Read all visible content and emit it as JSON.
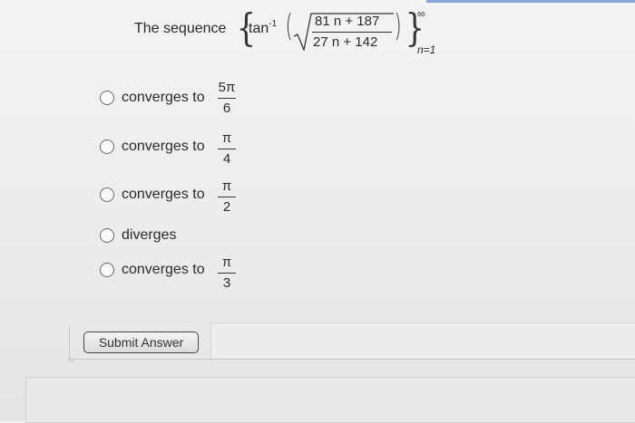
{
  "question": {
    "prefix": "The sequence",
    "open_brace": "{",
    "close_brace": "}",
    "func": "tan",
    "func_sup": "-1",
    "open_paren": "(",
    "close_paren": ")",
    "numerator": "81 n + 187",
    "denominator": "27 n + 142",
    "upper": "∞",
    "lower": "n=1"
  },
  "options": [
    {
      "text": "converges to",
      "num": "5π",
      "den": "6"
    },
    {
      "text": "converges to",
      "num": "π",
      "den": "4"
    },
    {
      "text": "converges to",
      "num": "π",
      "den": "2"
    },
    {
      "text": "diverges"
    },
    {
      "text": "converges to",
      "num": "π",
      "den": "3"
    }
  ],
  "submit_label": "Submit Answer"
}
